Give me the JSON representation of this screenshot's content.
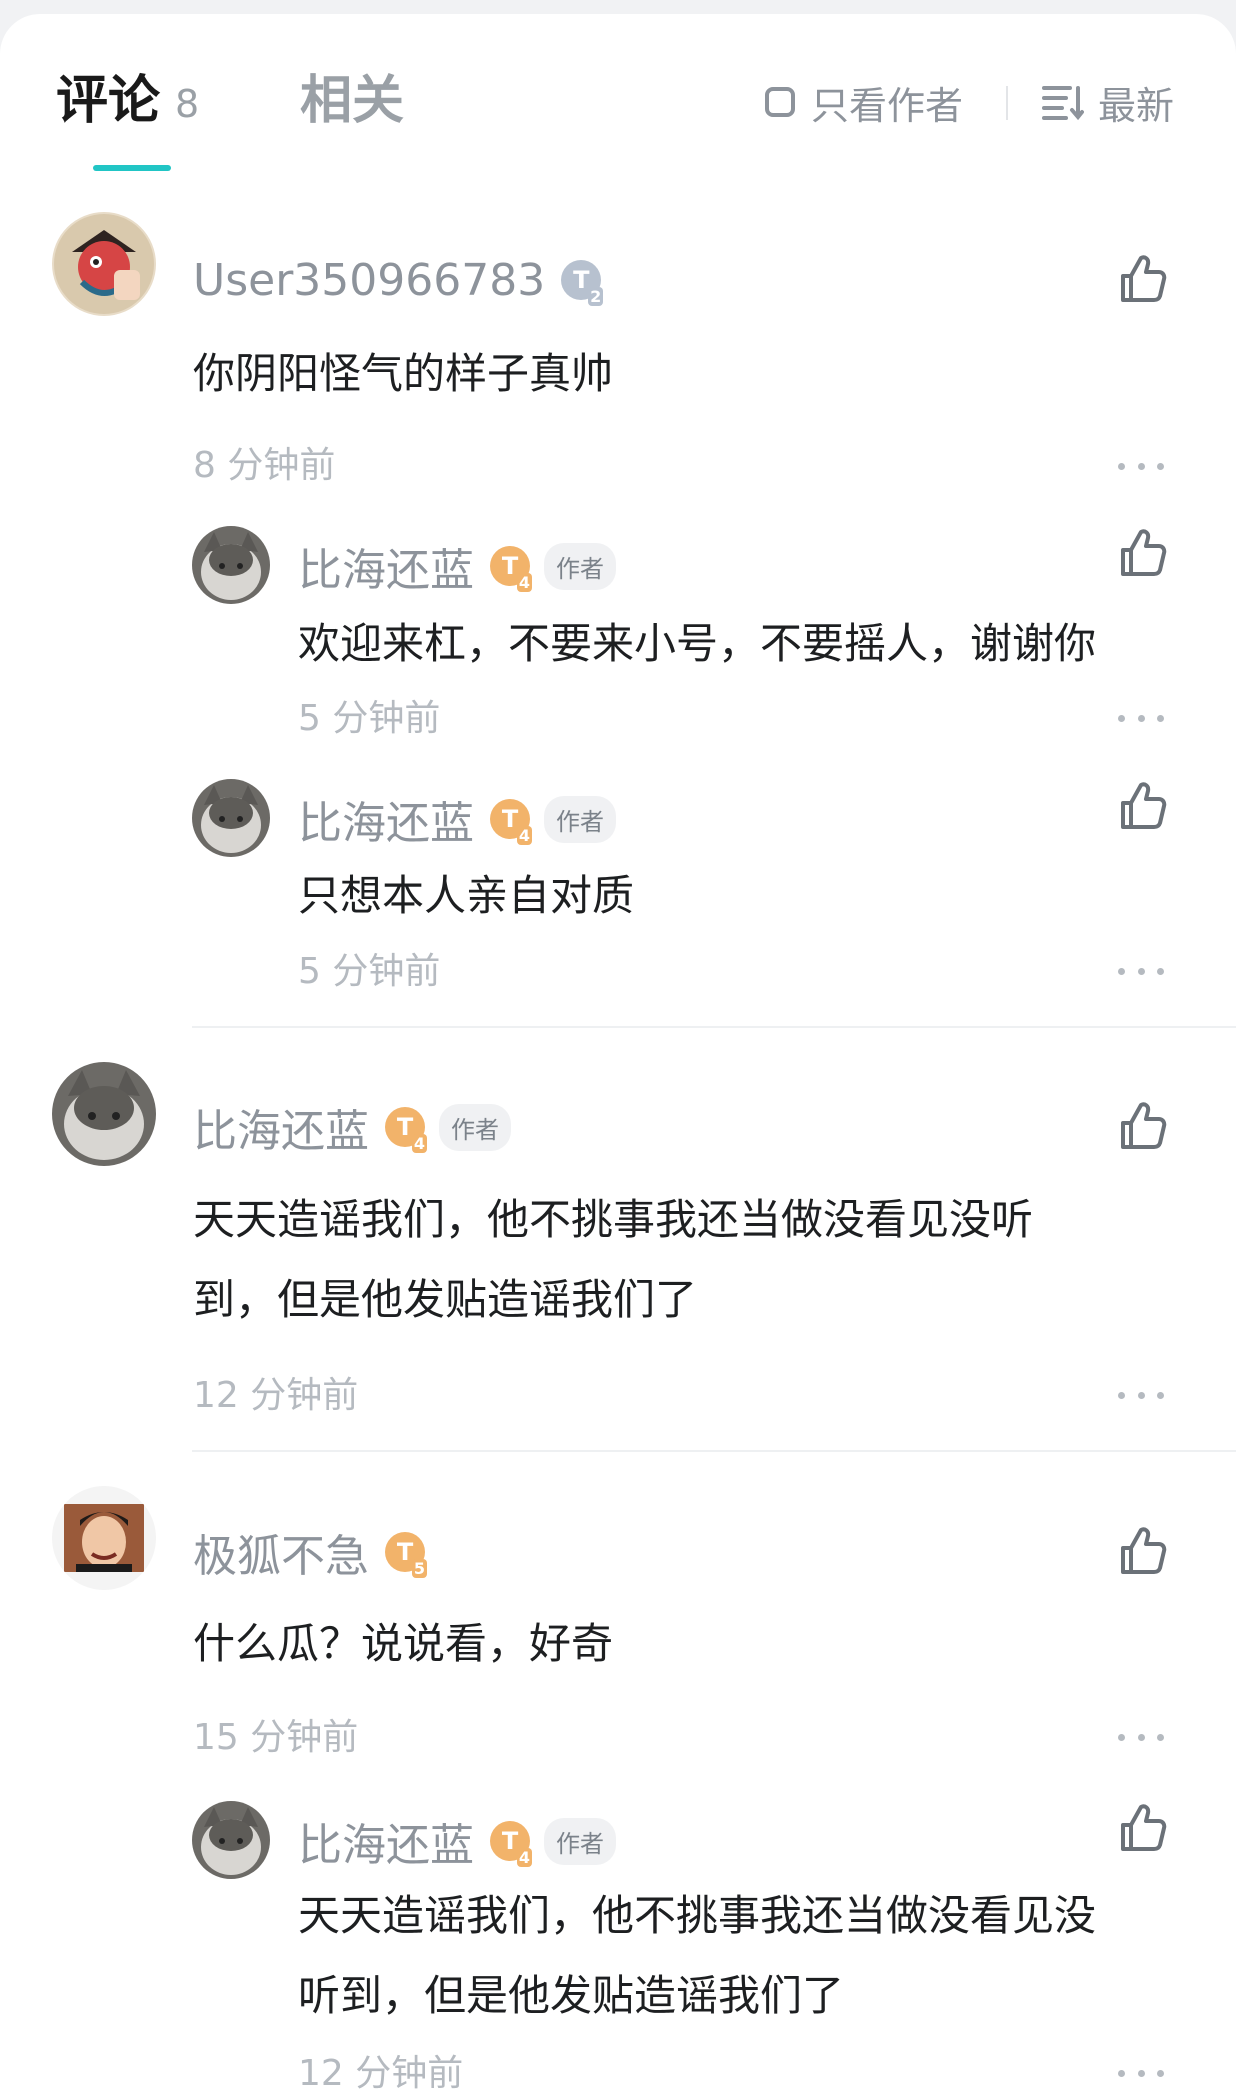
{
  "tabs": {
    "comments_label": "评论",
    "comments_count": "8",
    "related_label": "相关",
    "author_only_label": "只看作者",
    "sort_label": "最新"
  },
  "colors": {
    "accent": "#21c5c5",
    "muted_text": "#8d939b",
    "badge_orange": "#f2b36a",
    "badge_gray": "#b7c1cf"
  },
  "comments": [
    {
      "username": "User350966783",
      "level_badge": "T2",
      "level_letter": "T",
      "level_num": "2",
      "content": "你阴阳怪气的样子真帅",
      "time": "8 分钟前",
      "replies": [
        {
          "username": "比海还蓝",
          "level_letter": "T",
          "level_num": "4",
          "author_tag": "作者",
          "content": "欢迎来杠，不要来小号，不要摇人，谢谢你",
          "time": "5 分钟前"
        },
        {
          "username": "比海还蓝",
          "level_letter": "T",
          "level_num": "4",
          "author_tag": "作者",
          "content": "只想本人亲自对质",
          "time": "5 分钟前"
        }
      ]
    },
    {
      "username": "比海还蓝",
      "level_letter": "T",
      "level_num": "4",
      "author_tag": "作者",
      "content_line1": "天天造谣我们，他不挑事我还当做没看见没听",
      "content_line2": "到，但是他发贴造谣我们了",
      "time": "12 分钟前"
    },
    {
      "username": "极狐不急",
      "level_letter": "T",
      "level_num": "5",
      "content": "什么瓜？说说看，好奇",
      "time": "15 分钟前",
      "replies": [
        {
          "username": "比海还蓝",
          "level_letter": "T",
          "level_num": "4",
          "author_tag": "作者",
          "content_line1": "天天造谣我们，他不挑事我还当做没看见没",
          "content_line2": "听到，但是他发贴造谣我们了",
          "time": "12 分钟前"
        }
      ]
    }
  ],
  "icons": {
    "like": "thumbs-up-icon",
    "more": "more-dots-icon",
    "sort": "sort-lines-icon",
    "checkbox": "checkbox-icon"
  }
}
